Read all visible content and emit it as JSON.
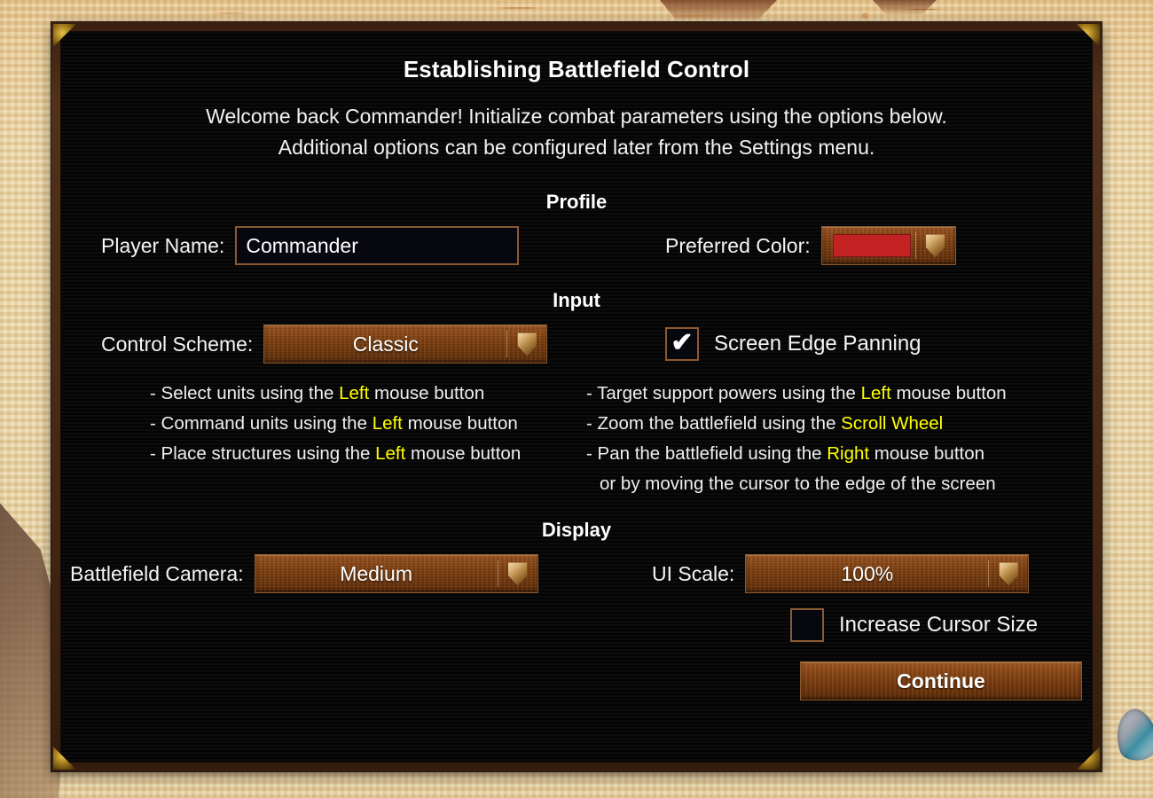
{
  "panel": {
    "title": "Establishing Battlefield Control",
    "welcome": "Welcome back Commander! Initialize combat parameters using the options below.\nAdditional options can be configured later from the Settings menu."
  },
  "sections": {
    "profile": "Profile",
    "input": "Input",
    "display": "Display"
  },
  "profile": {
    "player_name_label": "Player Name:",
    "player_name_value": "Commander",
    "player_name_placeholder": "Commander",
    "preferred_color_label": "Preferred Color:",
    "preferred_color_value": "#C32222",
    "dropdown_icon": "shield-chevron-icon"
  },
  "input": {
    "control_scheme_label": "Control Scheme:",
    "control_scheme_value": "Classic",
    "screen_edge_panning_label": "Screen Edge Panning",
    "screen_edge_panning_checked": true,
    "checkbox_tick": "✔",
    "hints_left": [
      {
        "pre": "- Select units using the ",
        "kw": "Left",
        "post": " mouse button"
      },
      {
        "pre": "- Command units using the ",
        "kw": "Left",
        "post": " mouse button"
      },
      {
        "pre": "- Place structures using the ",
        "kw": "Left",
        "post": " mouse button"
      }
    ],
    "hints_right": [
      {
        "pre": "- Target support powers using the ",
        "kw": "Left",
        "post": " mouse button"
      },
      {
        "pre": "- Zoom the battlefield using the ",
        "kw": "Scroll Wheel",
        "post": ""
      },
      {
        "pre": "- Pan the battlefield using the ",
        "kw": "Right",
        "post": " mouse button"
      }
    ],
    "hints_right_continuation": "or by moving the cursor to the edge of the screen"
  },
  "display": {
    "battlefield_camera_label": "Battlefield Camera:",
    "battlefield_camera_value": "Medium",
    "ui_scale_label": "UI Scale:",
    "ui_scale_value": "100%",
    "increase_cursor_size_label": "Increase Cursor Size",
    "increase_cursor_size_checked": false
  },
  "actions": {
    "continue_label": "Continue"
  },
  "theme": {
    "accent_wood": "#7A3C12",
    "border_tan": "#8A5A31",
    "highlight_yellow": "#FFFF00",
    "panel_black": "#080808",
    "text_white": "#FFFFFF"
  }
}
